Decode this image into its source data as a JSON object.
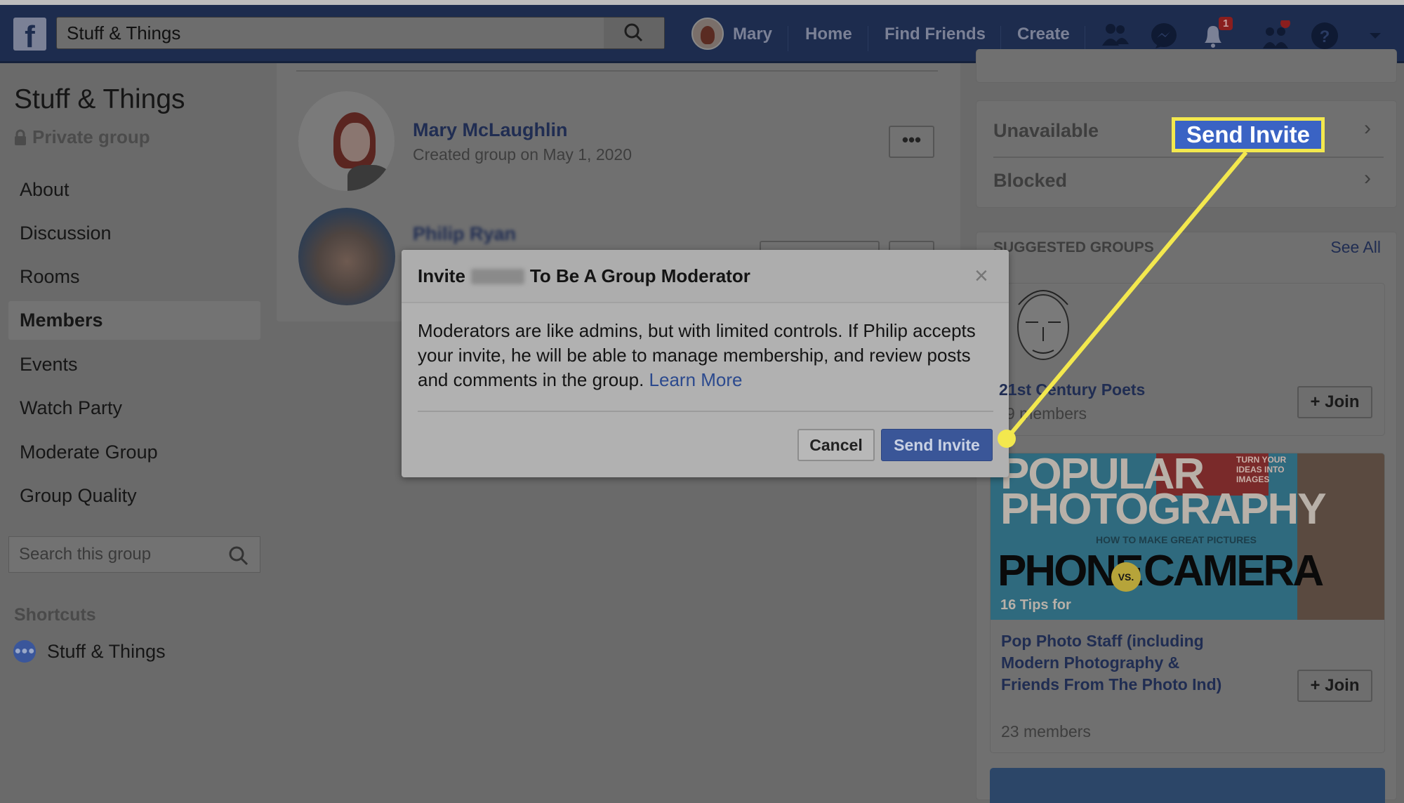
{
  "navbar": {
    "search_value": "Stuff & Things",
    "user_name": "Mary",
    "links": [
      "Home",
      "Find Friends",
      "Create"
    ],
    "notification_count": "1",
    "icons": [
      "friends-icon",
      "messenger-icon",
      "bell-icon",
      "people-icon",
      "help-icon",
      "caret-down-icon"
    ]
  },
  "sidebar": {
    "group_name": "Stuff & Things",
    "privacy": "Private group",
    "items": [
      {
        "label": "About"
      },
      {
        "label": "Discussion"
      },
      {
        "label": "Rooms"
      },
      {
        "label": "Members",
        "active": true
      },
      {
        "label": "Events"
      },
      {
        "label": "Watch Party"
      },
      {
        "label": "Moderate Group"
      },
      {
        "label": "Group Quality"
      }
    ],
    "search_placeholder": "Search this group",
    "shortcuts_label": "Shortcuts",
    "shortcut_item": "Stuff & Things"
  },
  "members": [
    {
      "name": "Mary McLaughlin",
      "subtitle": "Created group on May 1, 2020",
      "more": "•••"
    },
    {
      "name": "Philip Ryan",
      "blurred": true
    }
  ],
  "modal": {
    "title_prefix": "Invite",
    "title_suffix": "To Be A Group Moderator",
    "close": "×",
    "body": "Moderators are like admins, but with limited controls. If Philip accepts your invite, he will be able to manage membership, and review posts and comments in the group.",
    "learn_more": "Learn More",
    "cancel": "Cancel",
    "send": "Send Invite"
  },
  "right": {
    "rows": [
      "Unavailable",
      "Blocked"
    ],
    "suggested_title": "SUGGESTED GROUPS",
    "see_all": "See All",
    "groups": [
      {
        "name": "21st Century Poets",
        "visible_name": "1st Century Poets",
        "members": "9 members",
        "join": "+ Join"
      },
      {
        "name": "Pop Photo Staff (including Modern Photography & Friends From The Photo Ind)",
        "members": "23 members",
        "join": "+ Join",
        "cover_text": [
          "POPULAR",
          "PHOTOGRAPHY",
          "HOW TO MAKE GREAT PICTURES",
          "PHONE",
          "VS.",
          "CAMERA",
          "16 Tips for",
          "TURN YOUR IDEAS INTO IMAGES"
        ]
      }
    ]
  },
  "annotation": {
    "label": "Send Invite",
    "color": "#f3e84e"
  },
  "colors": {
    "brand": "#3b5998",
    "highlight": "#f3e84e"
  }
}
